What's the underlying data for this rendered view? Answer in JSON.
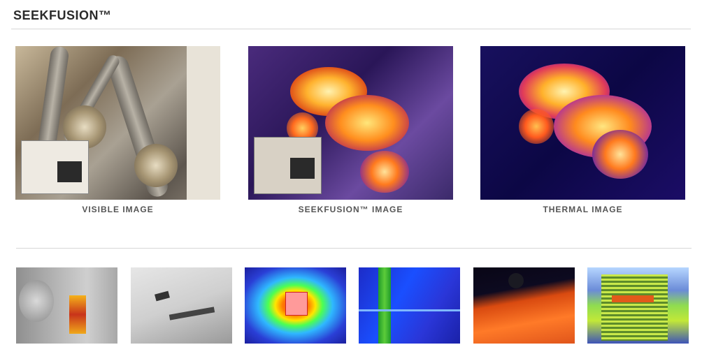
{
  "header": {
    "title": "SEEKFUSION™"
  },
  "main_images": [
    {
      "caption": "VISIBLE IMAGE"
    },
    {
      "caption": "SEEKFUSION™ IMAGE"
    },
    {
      "caption": "THERMAL IMAGE"
    }
  ],
  "gallery": {
    "thumbnails": [
      {
        "subject": "electric-meter-thermal"
      },
      {
        "subject": "ceiling-vent-grayscale-thermal"
      },
      {
        "subject": "wall-outlet-rainbow-thermal"
      },
      {
        "subject": "industrial-structure-thermal"
      },
      {
        "subject": "radiant-floor-heating-thermal"
      },
      {
        "subject": "ac-condenser-unit-thermal"
      }
    ]
  },
  "colors": {
    "rule": "#d6d6d6",
    "caption": "#555555",
    "title": "#2b2b2b"
  }
}
